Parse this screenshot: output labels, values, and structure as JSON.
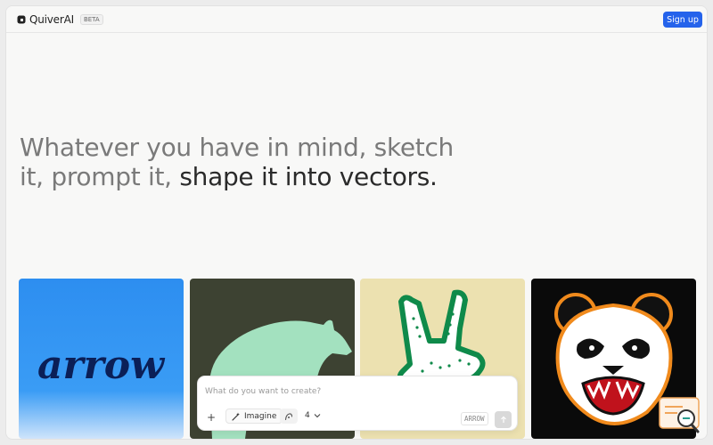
{
  "header": {
    "brand": "QuiverAI",
    "badge": "BETA",
    "signup_label": "Sign up"
  },
  "hero": {
    "light_text": "Whatever you have in mind, sketch it, prompt it, ",
    "dark_text": "shape it into vectors."
  },
  "gallery": {
    "cards": [
      {
        "icon": "arrow-wordmark",
        "text": "arrow",
        "bg": "#2d8ef0"
      },
      {
        "icon": "bear-silhouette",
        "bg": "#3d4232"
      },
      {
        "icon": "peace-hand",
        "bg": "#ece1b0"
      },
      {
        "icon": "panda-mascot",
        "bg": "#0a0a0a"
      }
    ]
  },
  "composer": {
    "placeholder": "What do you want to create?",
    "plus_label": "+",
    "imagine_label": "Imagine",
    "count_value": "4",
    "model_tag": "ARROW"
  },
  "colors": {
    "accent": "#2563eb",
    "background": "#f8f8f7"
  }
}
